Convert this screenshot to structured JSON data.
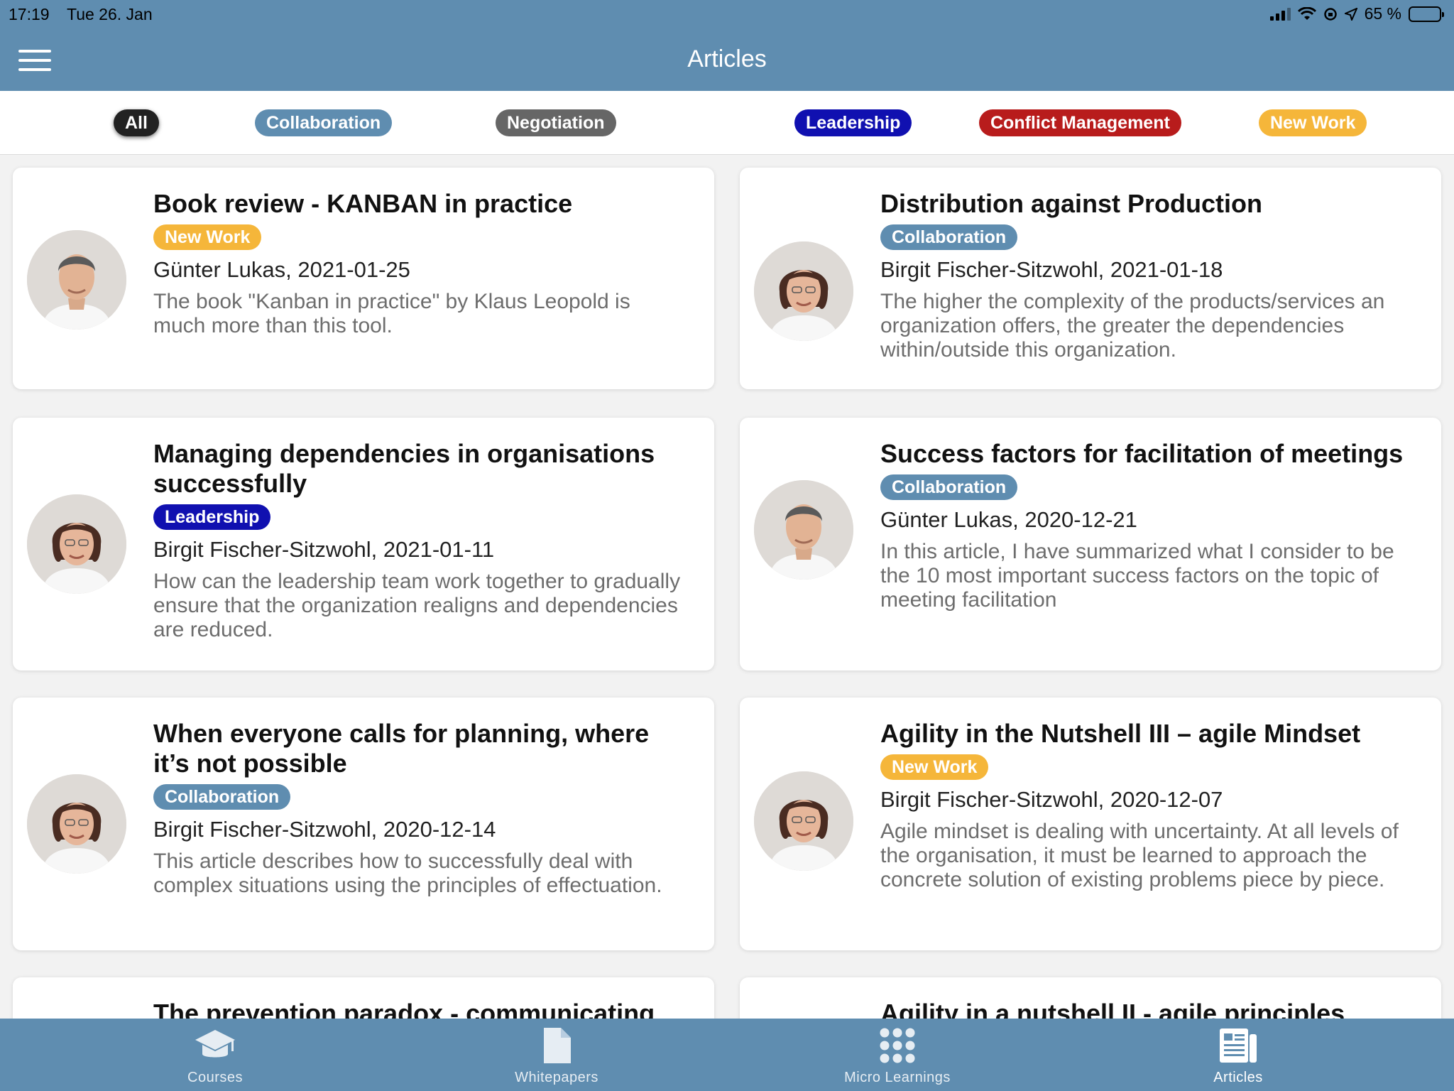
{
  "status": {
    "time": "17:19",
    "date": "Tue 26. Jan",
    "battery": "65 %",
    "battery_level": 0.65
  },
  "header": {
    "title": "Articles"
  },
  "filters": [
    {
      "label": "All",
      "color": "#222222",
      "active": true
    },
    {
      "label": "Collaboration",
      "color": "#5f8db0"
    },
    {
      "label": "Negotiation",
      "color": "#666666"
    },
    {
      "label": "Leadership",
      "color": "#1010b0"
    },
    {
      "label": "Conflict Management",
      "color": "#b81c1c"
    },
    {
      "label": "New Work",
      "color": "#f5b63a"
    }
  ],
  "articles": [
    {
      "title": "Book review - KANBAN in practice",
      "tag": "New Work",
      "tag_color": "#f5b63a",
      "author": "Günter Lukas, 2021-01-25",
      "excerpt": "The book \"Kanban in practice\" by Klaus Leopold is much more than this tool.",
      "avatar": "man"
    },
    {
      "title": "Distribution against Production",
      "tag": "Collaboration",
      "tag_color": "#5f8db0",
      "author": "Birgit Fischer-Sitzwohl, 2021-01-18",
      "excerpt": "The higher the complexity of the products/services an organization offers, the greater the dependencies within/outside this organization.",
      "avatar": "woman"
    },
    {
      "title": "Managing dependencies in organisations successfully",
      "tag": "Leadership",
      "tag_color": "#1010b0",
      "author": "Birgit Fischer-Sitzwohl, 2021-01-11",
      "excerpt": "How can the leadership team work together to gradually ensure that the organization realigns and dependencies are reduced.",
      "avatar": "woman"
    },
    {
      "title": "Success factors for facilitation of meetings",
      "tag": "Collaboration",
      "tag_color": "#5f8db0",
      "author": "Günter Lukas, 2020-12-21",
      "excerpt": "In this article, I have summarized what I consider to be the 10 most important success factors on the topic of meeting facilitation",
      "avatar": "man"
    },
    {
      "title": "When everyone calls for planning, where it’s not possible",
      "tag": "Collaboration",
      "tag_color": "#5f8db0",
      "author": "Birgit Fischer-Sitzwohl, 2020-12-14",
      "excerpt": "This article describes how to successfully deal with complex situations using the principles of effectuation.",
      "avatar": "woman"
    },
    {
      "title": "Agility in the Nutshell III – agile Mindset",
      "tag": "New Work",
      "tag_color": "#f5b63a",
      "author": "Birgit Fischer-Sitzwohl, 2020-12-07",
      "excerpt": "Agile mindset is dealing with uncertainty. At all levels of the organisation, it must be learned to approach the concrete solution of existing problems piece by piece.",
      "avatar": "woman"
    },
    {
      "title": "The prevention paradox - communicating",
      "tag": "",
      "tag_color": "",
      "author": "",
      "excerpt": "",
      "avatar": ""
    },
    {
      "title": "Agility in a nutshell II - agile principles",
      "tag": "",
      "tag_color": "",
      "author": "",
      "excerpt": "",
      "avatar": ""
    }
  ],
  "tabs": [
    {
      "label": "Courses",
      "icon": "graduation-cap-icon"
    },
    {
      "label": "Whitepapers",
      "icon": "document-icon"
    },
    {
      "label": "Micro Learnings",
      "icon": "dots-grid-icon"
    },
    {
      "label": "Articles",
      "icon": "newspaper-icon",
      "active": true
    }
  ]
}
